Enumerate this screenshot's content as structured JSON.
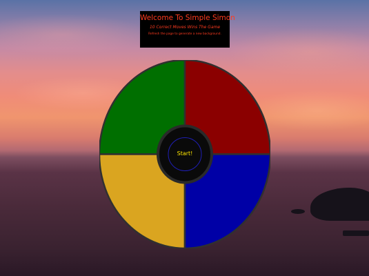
{
  "banner": {
    "title": "Welcome To Simple Simon",
    "subtitle": "10 Correct Moves Wins The Game",
    "note": "Refresh the page to generate a new background."
  },
  "game": {
    "start_label": "Start!",
    "pads": [
      {
        "id": "green",
        "color": "#006f00"
      },
      {
        "id": "red",
        "color": "#8b0000"
      },
      {
        "id": "yellow",
        "color": "#daa520"
      },
      {
        "id": "blue",
        "color": "#0000a6"
      }
    ],
    "hub_color": "#0a0a0a",
    "hub_ring_color": "#2a2a2a",
    "start_ring_color": "#1f1fb5",
    "outline_color": "#303030"
  },
  "colors": {
    "banner_text": "#ff3b1f",
    "start_text": "#ffe600"
  }
}
